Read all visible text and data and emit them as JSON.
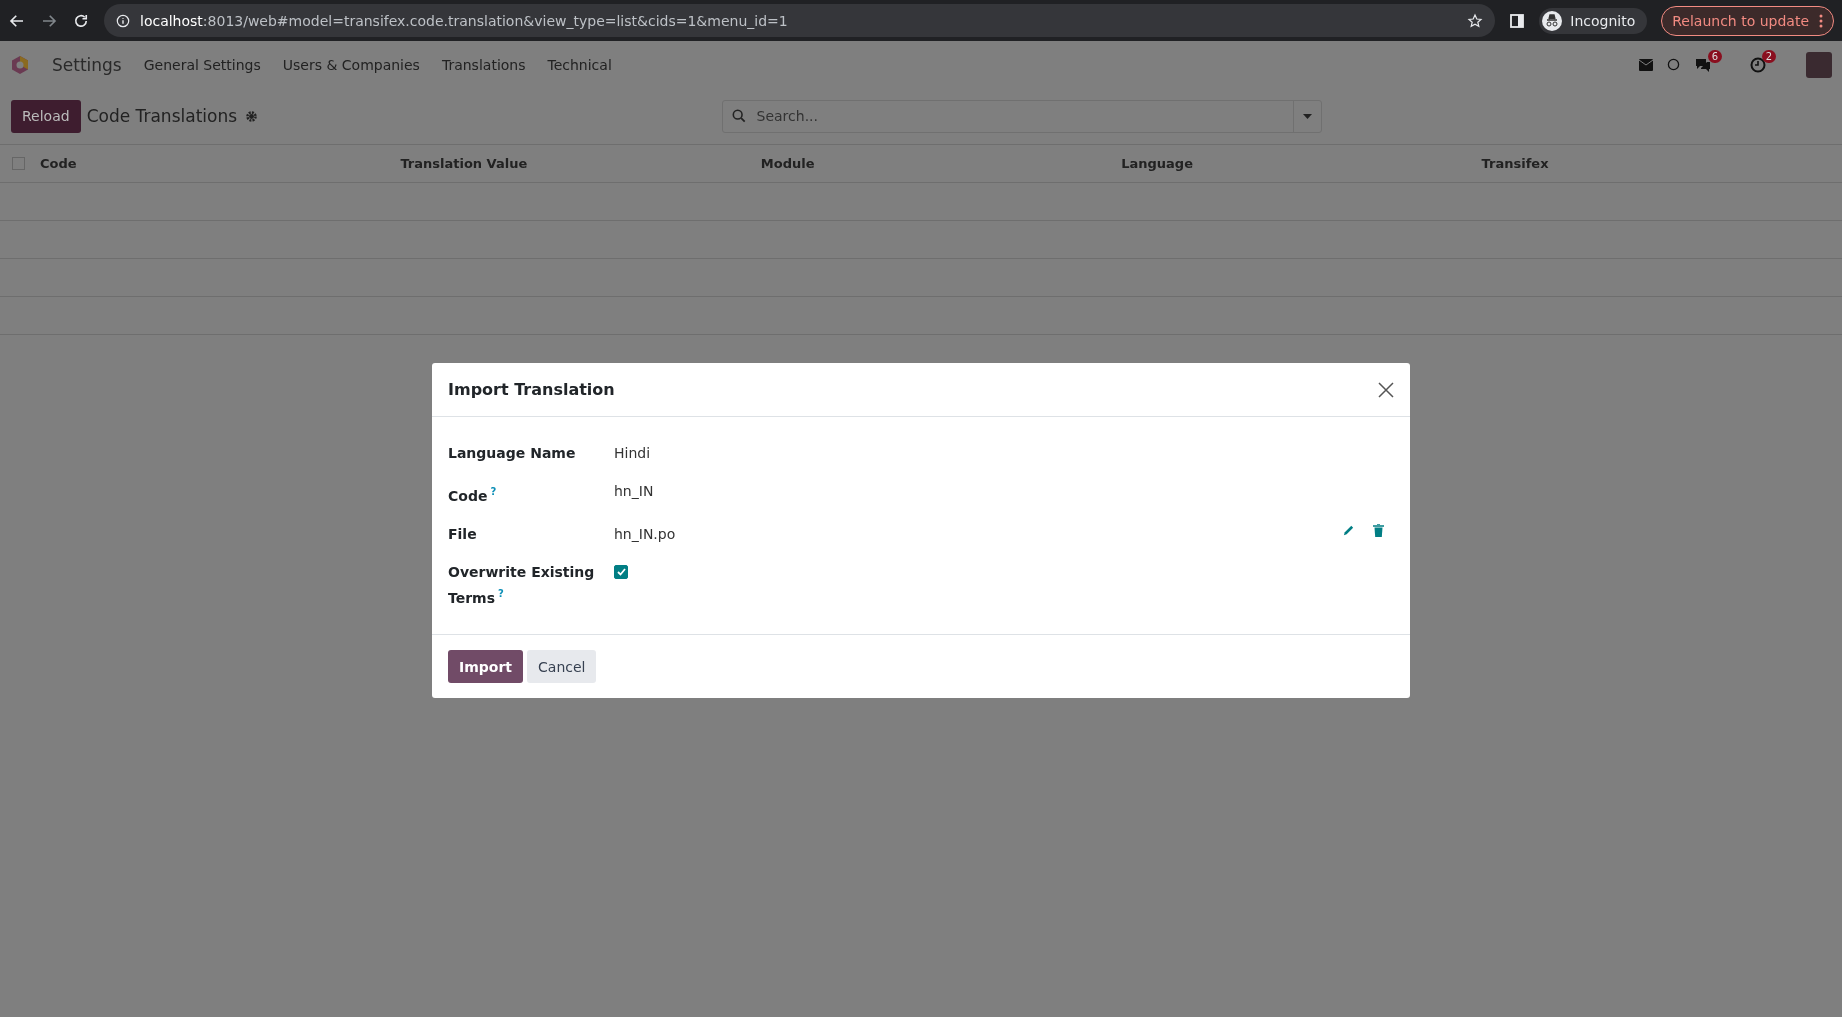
{
  "browser": {
    "url_host": "localhost",
    "url_path": ":8013/web#model=transifex.code.translation&view_type=list&cids=1&menu_id=1",
    "profile": "Incognito",
    "relaunch": "Relaunch to update"
  },
  "navbar": {
    "app_name": "Settings",
    "menu": [
      "General Settings",
      "Users & Companies",
      "Translations",
      "Technical"
    ],
    "badges": {
      "messages": "6",
      "activities": "2"
    }
  },
  "control_panel": {
    "button": "Reload",
    "title": "Code Translations",
    "search": {
      "placeholder": "Search..."
    }
  },
  "table": {
    "select_all": {
      "checked": false
    },
    "columns": [
      "Code",
      "Translation Value",
      "Module",
      "Language",
      "Transifex"
    ]
  },
  "dialog": {
    "title": "Import Translation",
    "fields": [
      {
        "kind": "text",
        "label": "Language Name",
        "value": "Hindi"
      },
      {
        "kind": "text",
        "label": "Code",
        "help": "?",
        "value": "hn_IN"
      },
      {
        "kind": "file",
        "label": "File",
        "value": "hn_IN.po"
      },
      {
        "kind": "checkbox",
        "label": "Overwrite Existing Terms",
        "help": "?",
        "checked": true
      }
    ],
    "buttons": [
      {
        "label": "Import",
        "kind": "primary"
      },
      {
        "label": "Cancel",
        "kind": "secondary"
      }
    ]
  }
}
